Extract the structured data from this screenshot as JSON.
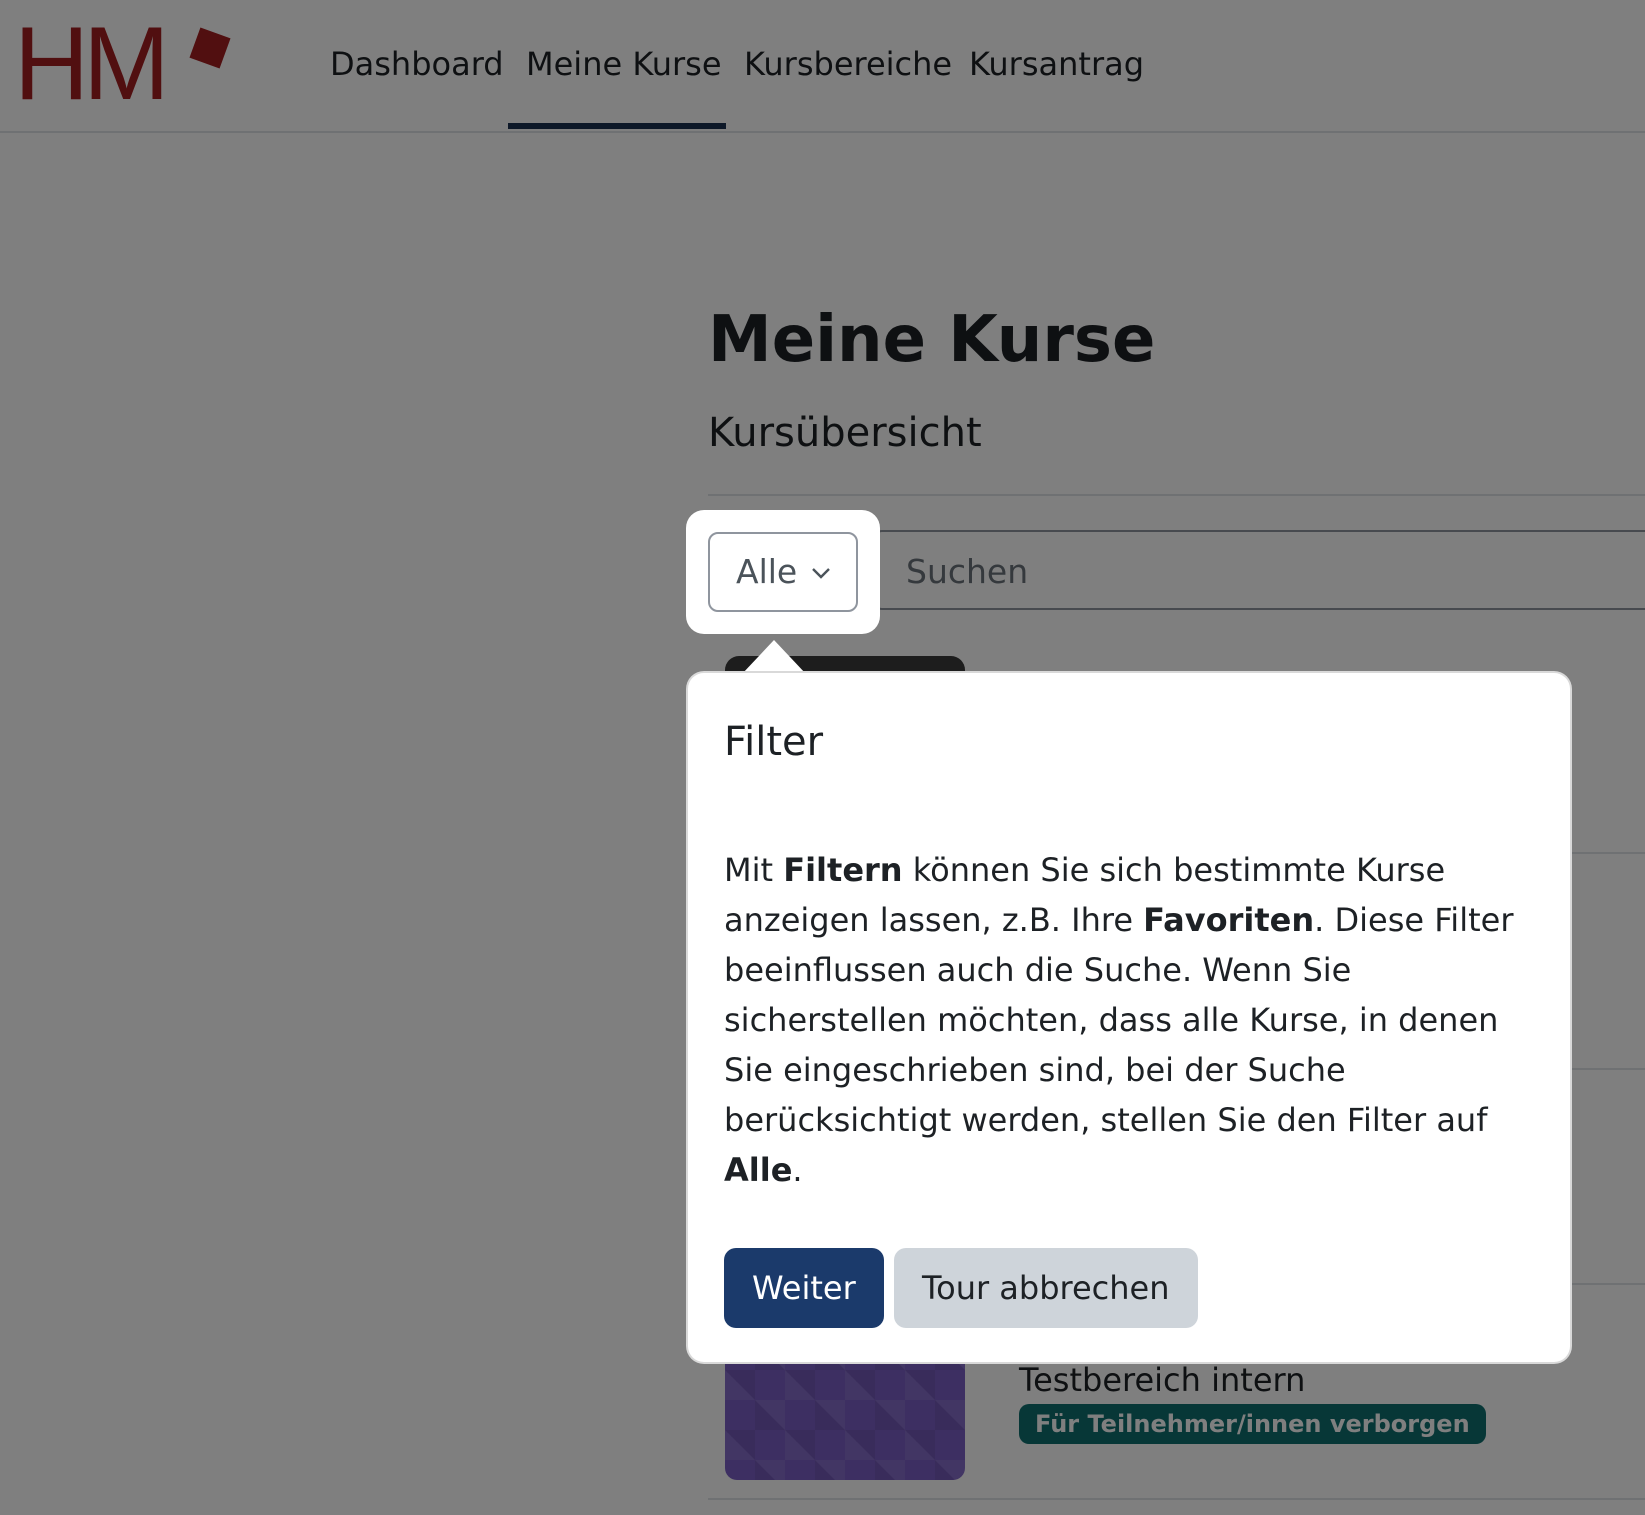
{
  "header": {
    "nav": [
      "Dashboard",
      "Meine Kurse",
      "Kursbereiche",
      "Kursantrag"
    ],
    "active_nav": "Meine Kurse"
  },
  "logo": {
    "text": "HM",
    "color": "#a31f20"
  },
  "page": {
    "title": "Meine Kurse",
    "block_title": "Kursübersicht"
  },
  "filter": {
    "selected": "Alle"
  },
  "search": {
    "placeholder": "Suchen"
  },
  "courses": [
    {
      "name": "Testbereich intern",
      "badge": "Für Teilnehmer/innen verborgen"
    }
  ],
  "tour": {
    "title": "Filter",
    "body": {
      "t1": "Mit ",
      "b1": "Filtern",
      "t2": " können Sie sich bestimmte Kurse anzeigen lassen, z.B. Ihre ",
      "b2": "Favoriten",
      "t3": ". Diese Filter beeinflussen auch die Suche. Wenn Sie sicherstellen möchten, dass alle Kurse, in denen Sie eingeschrieben sind, bei der Suche berücksichtigt werden, stellen Sie den Filter auf ",
      "b3": "Alle",
      "t4": "."
    },
    "next_label": "Weiter",
    "cancel_label": "Tour abbrechen"
  },
  "colors": {
    "primary_button": "#1b3a6b",
    "badge": "#0f6f6f",
    "logo": "#a31f20",
    "overlay": "rgba(0,0,0,0.5)"
  }
}
